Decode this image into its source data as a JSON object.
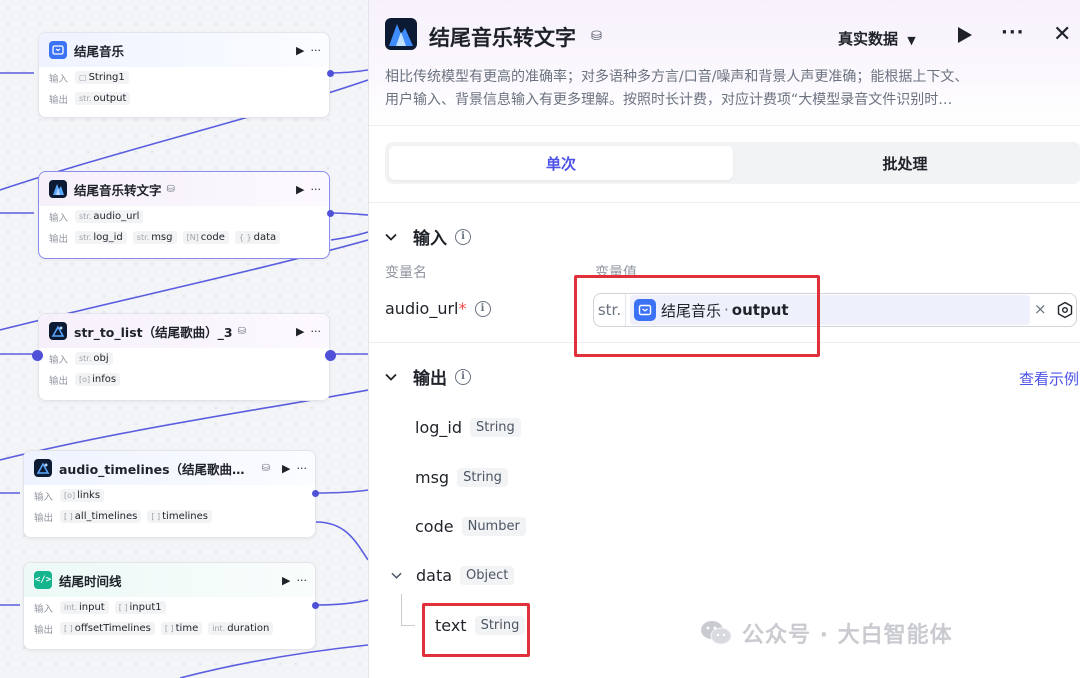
{
  "canvas": {
    "nodes": [
      {
        "title": "结尾音乐",
        "input_label": "输入",
        "inputs": [
          {
            "type": "▢",
            "name": "String1"
          }
        ],
        "output_label": "输出",
        "outputs": [
          {
            "type": "str.",
            "name": "output"
          }
        ]
      },
      {
        "title": "结尾音乐转文字",
        "input_label": "输入",
        "inputs": [
          {
            "type": "str.",
            "name": "audio_url"
          }
        ],
        "output_label": "输出",
        "outputs": [
          {
            "type": "str.",
            "name": "log_id"
          },
          {
            "type": "str.",
            "name": "msg"
          },
          {
            "type": "[N]",
            "name": "code"
          },
          {
            "type": "{ }",
            "name": "data"
          }
        ]
      },
      {
        "title": "str_to_list（结尾歌曲）_3",
        "input_label": "输入",
        "inputs": [
          {
            "type": "str.",
            "name": "obj"
          }
        ],
        "output_label": "输出",
        "outputs": [
          {
            "type": "[o]",
            "name": "infos"
          }
        ]
      },
      {
        "title": "audio_timelines（结尾歌曲…",
        "input_label": "输入",
        "inputs": [
          {
            "type": "[o]",
            "name": "links"
          }
        ],
        "output_label": "输出",
        "outputs": [
          {
            "type": "[ ]",
            "name": "all_timelines"
          },
          {
            "type": "[ ]",
            "name": "timelines"
          }
        ]
      },
      {
        "title": "结尾时间线",
        "input_label": "输入",
        "inputs": [
          {
            "type": "int.",
            "name": "input"
          },
          {
            "type": "[ ]",
            "name": "input1"
          }
        ],
        "output_label": "输出",
        "outputs": [
          {
            "type": "[ ]",
            "name": "offsetTimelines"
          },
          {
            "type": "[ ]",
            "name": "time"
          },
          {
            "type": "int.",
            "name": "duration"
          }
        ]
      }
    ],
    "play_glyph": "▶",
    "more_glyph": "···",
    "code_icon_text": "</>"
  },
  "panel": {
    "title": "结尾音乐转文字",
    "real_data_label": "真实数据",
    "real_data_caret": "▼",
    "more_glyph": "···",
    "close_glyph": "✕",
    "description_lines": [
      "相比传统模型有更高的准确率；对多语种多方言/口音/噪声和背景人声更准确；能根据上下文、",
      "用户输入、背景信息输入有更多理解。按照时长计费，对应计费项“大模型录音文件识别时…"
    ],
    "tabs": [
      {
        "label": "单次",
        "active": true
      },
      {
        "label": "批处理",
        "active": false
      }
    ],
    "input_section": {
      "title": "输入",
      "col_name": "变量名",
      "col_value": "变量值",
      "param_name": "audio_url",
      "required_mark": "*",
      "value_type": "str.",
      "value_node": "结尾音乐",
      "value_sep": "·",
      "value_var": "output",
      "clear_glyph": "×"
    },
    "output_section": {
      "title": "输出",
      "view_example": "查看示例",
      "outputs": [
        {
          "name": "log_id",
          "type": "String"
        },
        {
          "name": "msg",
          "type": "String"
        },
        {
          "name": "code",
          "type": "Number"
        },
        {
          "name": "data",
          "type": "Object"
        },
        {
          "name": "text",
          "type": "String"
        }
      ]
    }
  },
  "watermark": "公众号 · 大白智能体",
  "colors": {
    "accent": "#4d53e8",
    "highlight": "#e0313a",
    "edge": "#4f52d8"
  }
}
